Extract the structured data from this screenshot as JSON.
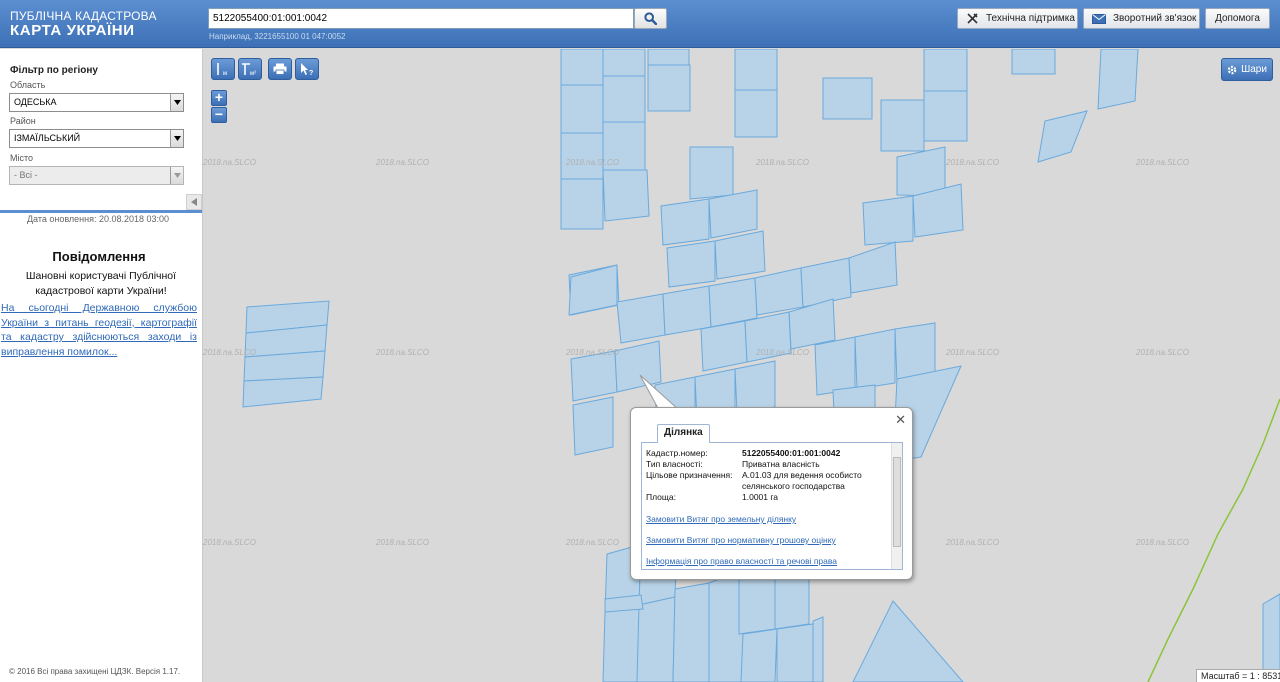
{
  "header": {
    "logo_top": "ПУБЛІЧНА КАДАСТРОВА",
    "logo_bottom": "КАРТА УКРАЇНИ",
    "search_value": "5122055400:01:001:0042",
    "search_hint": "Наприклад, 3221655100 01 047:0052",
    "support_label": "Технічна підтримка",
    "feedback_label": "Зворотний зв'язок",
    "help_label": "Допомога"
  },
  "sidebar": {
    "filter_title": "Фільтр по регіону",
    "region_label": "Область",
    "region_value": "ОДЕСЬКА",
    "district_label": "Район",
    "district_value": "ІЗМАЇЛЬСЬКИЙ",
    "city_label": "Місто",
    "city_value": "- Всі -",
    "update_date": "Дата оновлення: 20.08.2018 03:00",
    "news_title": "Повідомлення",
    "news_greeting": "Шановні користувачі Публічної кадастрової карти України!",
    "news_link": "На сьогодні Державною службою України з питань геодезії, картографії та кадастру здійснюються заходи із виправлення помилок...",
    "copyright": "© 2016 Всі права захищені ЦДЗК. Версія 1.17."
  },
  "map": {
    "layers_label": "Шари",
    "scale_text": "Масштаб = 1 : 8531",
    "watermark": "2018.na.SLCO",
    "parcel_color": "#b8d3e8",
    "parcel_stroke": "#6aa9dc"
  },
  "popup": {
    "tab_label": "Ділянка",
    "cadastre_key": "Кадастр.номер:",
    "cadastre_value": "5122055400:01:001:0042",
    "ownership_key": "Тип власності:",
    "ownership_value": "Приватна власність",
    "purpose_key": "Цільове призначення:",
    "purpose_value": "A.01.03 для ведення особисто селянського господарства",
    "area_key": "Площа:",
    "area_value": "1.0001 га",
    "link_extract": "Замовити Витяг про земельну ділянку",
    "link_valuation": "Замовити Витяг про нормативну грошову оцінку",
    "link_rights": "Інформація про право власності та речові права"
  }
}
